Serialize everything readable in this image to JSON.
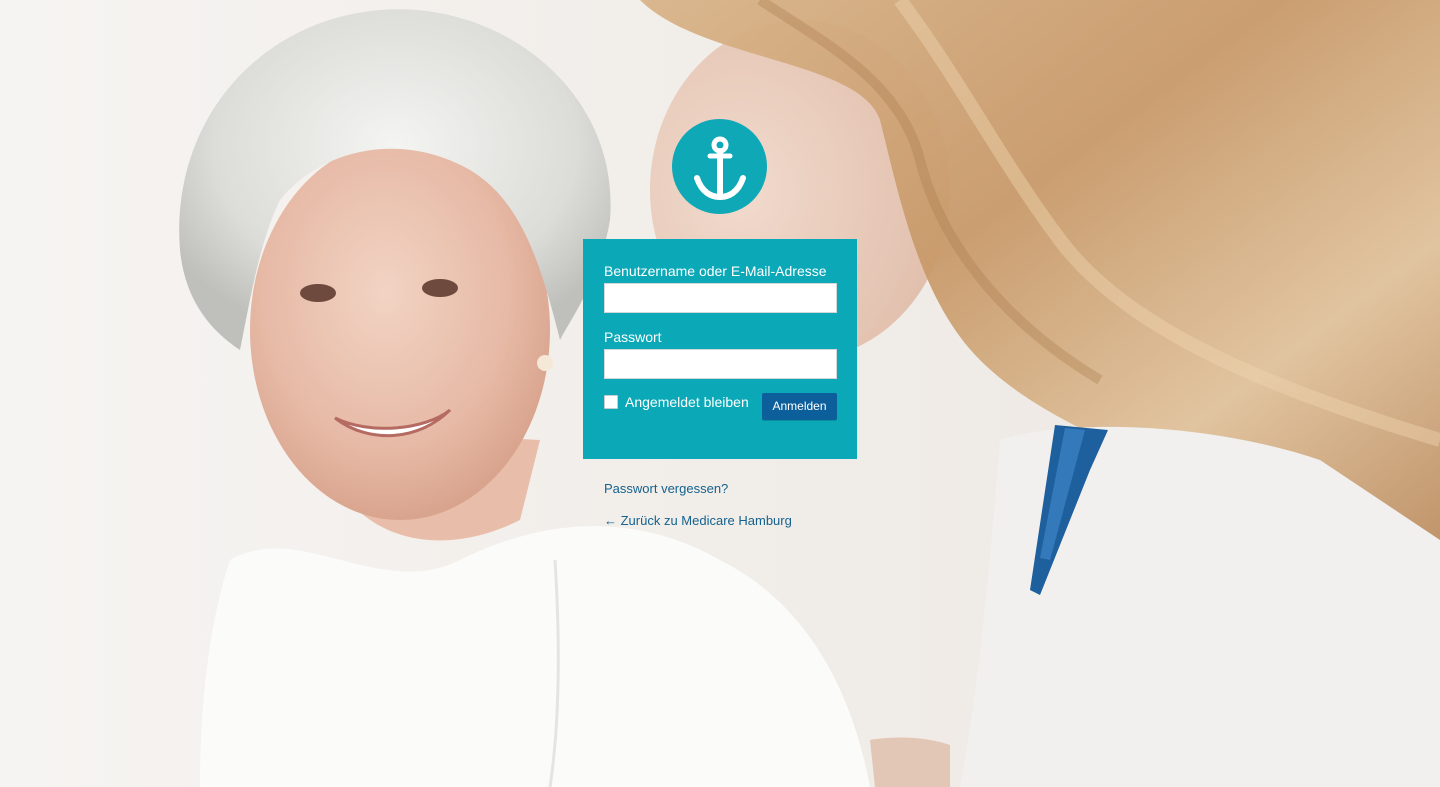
{
  "brand": {
    "logo_icon": "anchor-icon",
    "logo_color": "#0ea8b6"
  },
  "form": {
    "background_color": "#0ba9b7",
    "username_label": "Benutzername oder E-Mail-Adresse",
    "username_value": "",
    "password_label": "Passwort",
    "password_value": "",
    "remember_label": "Angemeldet bleiben",
    "remember_checked": false,
    "submit_label": "Anmelden",
    "submit_color": "#0d5f9c"
  },
  "links": {
    "lost_password": "Passwort vergessen?",
    "back_to_site": "← Zurück zu Medicare Hamburg",
    "link_color": "#15628f"
  }
}
